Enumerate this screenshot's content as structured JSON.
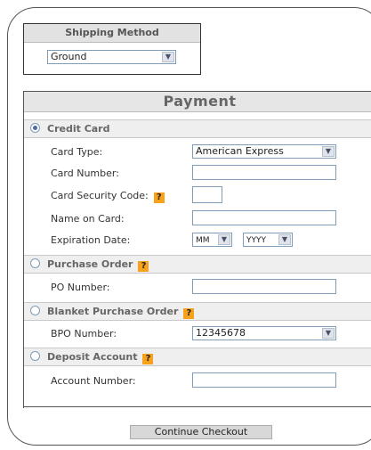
{
  "shipping": {
    "title": "Shipping Method",
    "method_value": "Ground"
  },
  "payment": {
    "title": "Payment",
    "credit_card": {
      "label": "Credit Card",
      "card_type_label": "Card Type:",
      "card_type_value": "American Express",
      "card_number_label": "Card Number:",
      "card_number_value": "",
      "security_code_label": "Card Security Code:",
      "security_code_value": "",
      "name_on_card_label": "Name on Card:",
      "name_on_card_value": "",
      "expiration_label": "Expiration Date:",
      "exp_month_value": "MM",
      "exp_year_value": "YYYY"
    },
    "purchase_order": {
      "label": "Purchase Order",
      "po_number_label": "PO Number:",
      "po_number_value": ""
    },
    "blanket_po": {
      "label": "Blanket Purchase Order",
      "bpo_number_label": "BPO Number:",
      "bpo_number_value": "12345678"
    },
    "deposit_account": {
      "label": "Deposit Account",
      "account_number_label": "Account Number:",
      "account_number_value": ""
    },
    "help_glyph": "?",
    "selected_method": "credit_card"
  },
  "continue_label": "Continue Checkout",
  "icons": {
    "dropdown": "chevron-down-icon",
    "help": "help-icon",
    "radio": "radio-icon"
  },
  "colors": {
    "help_badge": "#f7a21a",
    "section_bg": "#efefef",
    "header_bg": "#e6e6e6",
    "button_bg": "#d8d8d8"
  }
}
